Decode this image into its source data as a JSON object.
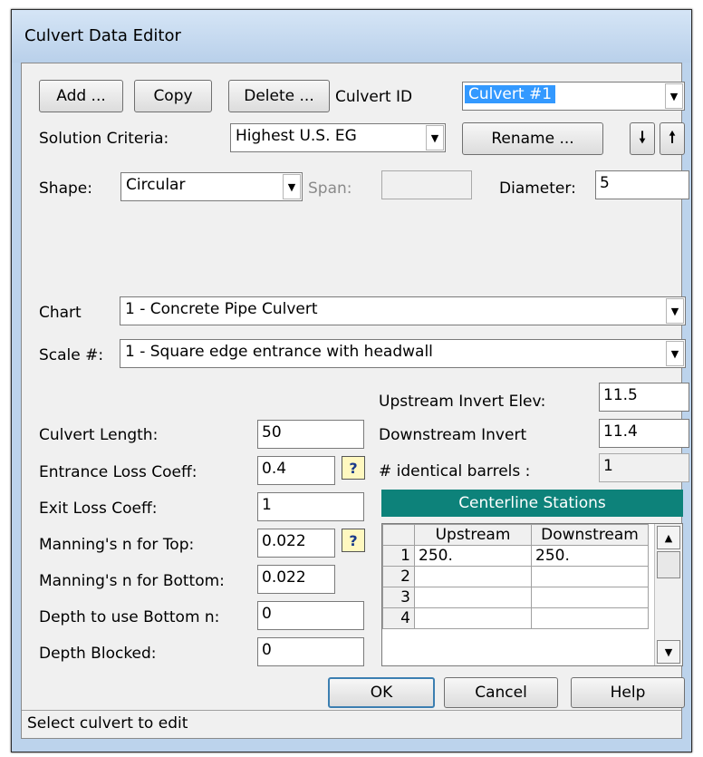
{
  "window": {
    "title": "Culvert Data Editor"
  },
  "toolbar": {
    "add_label": "Add ...",
    "copy_label": "Copy",
    "delete_label": "Delete ...",
    "culvert_id_label": "Culvert ID",
    "culvert_id_value": "Culvert #1",
    "rename_label": "Rename ...",
    "down_arrow": "🠗",
    "up_arrow": "🠕"
  },
  "solution": {
    "label": "Solution Criteria:",
    "value": "Highest U.S. EG"
  },
  "shape": {
    "label": "Shape:",
    "value": "Circular",
    "span_label": "Span:",
    "span_value": "",
    "diameter_label": "Diameter:",
    "diameter_value": "5"
  },
  "chart": {
    "label": "Chart",
    "value": "1 - Concrete Pipe Culvert"
  },
  "scale": {
    "label": "Scale #:",
    "value": "1 - Square edge entrance with headwall"
  },
  "fields": {
    "upstream_invert_label": "Upstream Invert Elev:",
    "upstream_invert_value": "11.5",
    "culvert_length_label": "Culvert Length:",
    "culvert_length_value": "50",
    "downstream_invert_label": "Downstream Invert",
    "downstream_invert_value": "11.4",
    "entrance_loss_label": "Entrance Loss Coeff:",
    "entrance_loss_value": "0.4",
    "barrels_label": "# identical barrels :",
    "barrels_value": "1",
    "exit_loss_label": "Exit Loss Coeff:",
    "exit_loss_value": "1",
    "mannings_top_label": "Manning's n for Top:",
    "mannings_top_value": "0.022",
    "mannings_bottom_label": "Manning's n for Bottom:",
    "mannings_bottom_value": "0.022",
    "depth_bottom_label": "Depth to use Bottom n:",
    "depth_bottom_value": "0",
    "depth_blocked_label": "Depth Blocked:",
    "depth_blocked_value": "0",
    "help_glyph": "?"
  },
  "stations": {
    "title": "Centerline Stations",
    "columns": [
      "",
      "Upstream",
      "Downstream"
    ],
    "rows": [
      {
        "n": "1",
        "up": "250.",
        "down": "250."
      },
      {
        "n": "2",
        "up": "",
        "down": ""
      },
      {
        "n": "3",
        "up": "",
        "down": ""
      },
      {
        "n": "4",
        "up": "",
        "down": ""
      }
    ]
  },
  "buttons": {
    "ok": "OK",
    "cancel": "Cancel",
    "help": "Help"
  },
  "status": {
    "text": "Select culvert to edit"
  }
}
